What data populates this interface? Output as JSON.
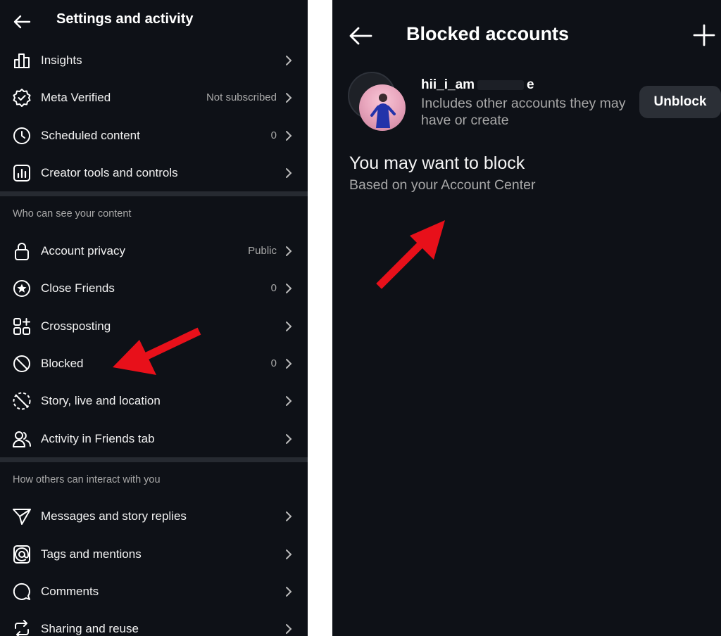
{
  "left": {
    "title": "Settings and activity",
    "rows_top": [
      {
        "label": "Insights",
        "value": "",
        "icon": "insights-icon"
      },
      {
        "label": "Meta Verified",
        "value": "Not subscribed",
        "icon": "verified-badge-icon"
      },
      {
        "label": "Scheduled content",
        "value": "0",
        "icon": "clock-icon"
      },
      {
        "label": "Creator tools and controls",
        "value": "",
        "icon": "creator-tools-icon"
      }
    ],
    "section1": "Who can see your content",
    "rows_privacy": [
      {
        "label": "Account privacy",
        "value": "Public",
        "icon": "lock-icon"
      },
      {
        "label": "Close Friends",
        "value": "0",
        "icon": "star-icon"
      },
      {
        "label": "Crossposting",
        "value": "",
        "icon": "crossposting-icon"
      },
      {
        "label": "Blocked",
        "value": "0",
        "icon": "blocked-icon"
      },
      {
        "label": "Story, live and location",
        "value": "",
        "icon": "story-icon"
      },
      {
        "label": "Activity in Friends tab",
        "value": "",
        "icon": "friends-icon"
      }
    ],
    "section2": "How others can interact with you",
    "rows_interact": [
      {
        "label": "Messages and story replies",
        "value": "",
        "icon": "messages-icon"
      },
      {
        "label": "Tags and mentions",
        "value": "",
        "icon": "at-icon"
      },
      {
        "label": "Comments",
        "value": "",
        "icon": "comment-icon"
      },
      {
        "label": "Sharing and reuse",
        "value": "",
        "icon": "share-icon"
      }
    ]
  },
  "right": {
    "title": "Blocked accounts",
    "account": {
      "name_start": "hii_i_am",
      "name_end": "e",
      "subtitle": "Includes other accounts they may have or create",
      "unblock_label": "Unblock"
    },
    "suggest_title": "You may want to block",
    "suggest_subtitle": "Based on your Account Center"
  },
  "colors": {
    "background": "#0e1117",
    "divider": "#262a31",
    "secondary_text": "#a8a8a8",
    "arrow": "#e8101a",
    "button": "#2b2f36"
  }
}
